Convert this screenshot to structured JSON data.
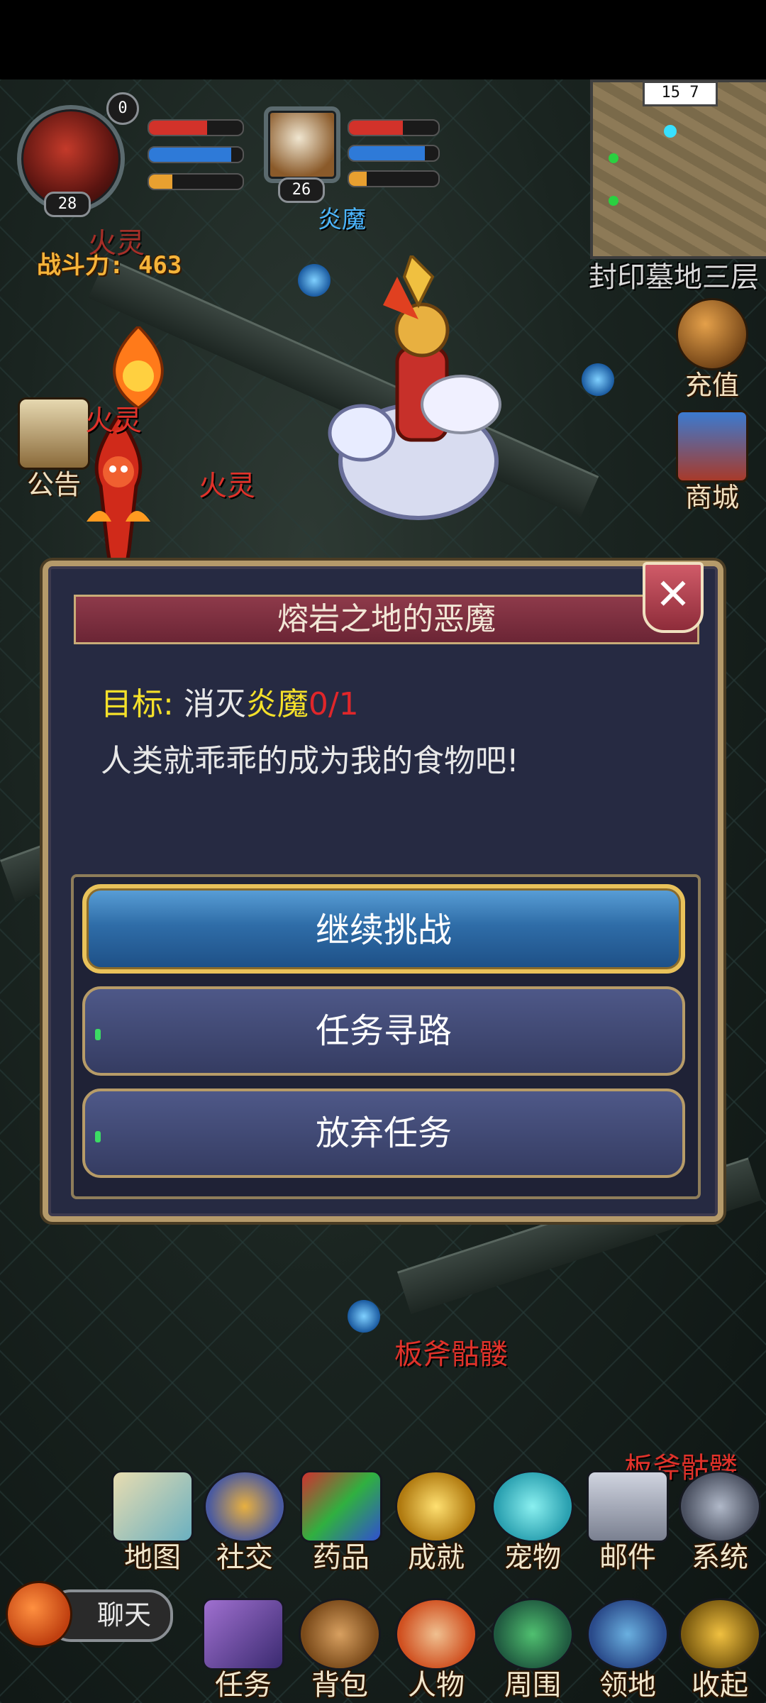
{
  "hud": {
    "player_level": "28",
    "pet_level": "26",
    "pet_name": "炎魔",
    "combat_power": "战斗力: 463",
    "notification_count": "0",
    "player_hp": 0.62,
    "player_mp": 0.88,
    "player_exp": 0.25,
    "pet_hp": 0.6,
    "pet_mp": 0.85,
    "pet_exp": 0.2
  },
  "minimap": {
    "coords": "15 7",
    "map_name": "封印墓地三层"
  },
  "side_right": [
    {
      "label": "充值"
    },
    {
      "label": "商城"
    }
  ],
  "side_left": [
    {
      "label": "公告"
    }
  ],
  "mob_labels": [
    "火灵",
    "火灵",
    "火灵",
    "板斧骷髅",
    "板斧骷髅"
  ],
  "dialog": {
    "title": "熔岩之地的恶魔",
    "goal_label": "目标:",
    "goal_action": "消灭",
    "goal_target": "炎魔",
    "goal_progress": "0/1",
    "description": "人类就乖乖的成为我的食物吧!",
    "buttons": [
      "继续挑战",
      "任务寻路",
      "放弃任务"
    ]
  },
  "menu_row1": [
    {
      "label": "地图"
    },
    {
      "label": "社交"
    },
    {
      "label": "药品"
    },
    {
      "label": "成就"
    },
    {
      "label": "宠物"
    },
    {
      "label": "邮件"
    },
    {
      "label": "系统"
    }
  ],
  "menu_row2": [
    {
      "label": "任务"
    },
    {
      "label": "背包"
    },
    {
      "label": "人物"
    },
    {
      "label": "周围"
    },
    {
      "label": "领地"
    },
    {
      "label": "收起"
    }
  ],
  "chat": {
    "label": "聊天"
  },
  "colors": {
    "dialog_bg": "#262a42",
    "title_bar": "#8e3a4a",
    "gold_border": "#b59a6a",
    "primary_button": "#2f6da8",
    "goal_yellow": "#f4e02a",
    "progress_red": "#e0262a"
  }
}
